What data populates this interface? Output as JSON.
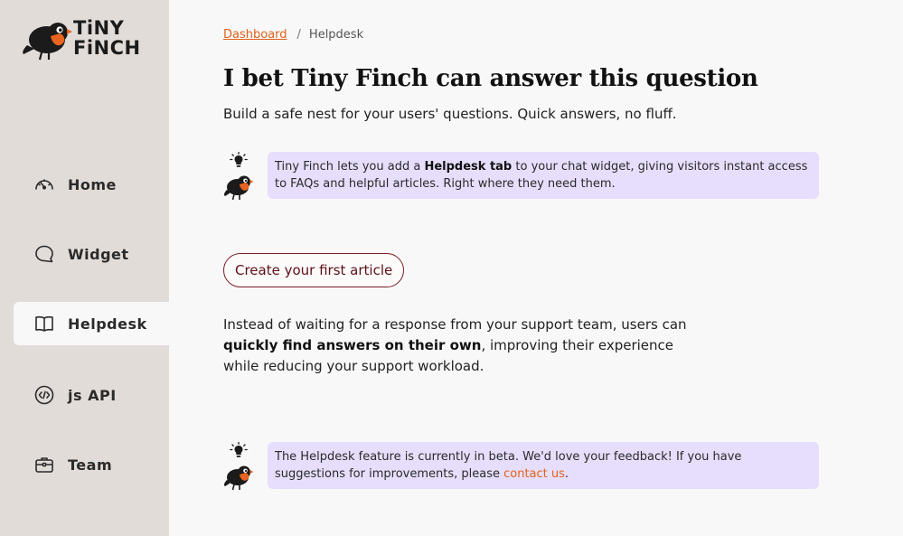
{
  "brand": {
    "line1": "TiNY",
    "line2": "FiNCH"
  },
  "sidebar": {
    "items": [
      {
        "label": "Home",
        "icon": "gauge-icon",
        "active": false
      },
      {
        "label": "Widget",
        "icon": "chat-bubble-icon",
        "active": false
      },
      {
        "label": "Helpdesk",
        "icon": "open-book-icon",
        "active": true
      },
      {
        "label": "js API",
        "icon": "code-icon",
        "active": false
      },
      {
        "label": "Team",
        "icon": "briefcase-icon",
        "active": false
      }
    ]
  },
  "breadcrumb": {
    "parent": "Dashboard",
    "separator": "/",
    "current": "Helpdesk"
  },
  "page": {
    "title": "I bet Tiny Finch can answer this question",
    "subtitle": "Build a safe nest for your users' questions. Quick answers, no fluff."
  },
  "tip1": {
    "text_a": "Tiny Finch lets you add a ",
    "bold": "Helpdesk tab",
    "text_b": " to your chat widget, giving visitors instant access to FAQs and helpful articles. Right where they need them."
  },
  "cta": {
    "label": "Create your first article"
  },
  "description": {
    "text_a": "Instead of waiting for a response from your support team, users can ",
    "bold": "quickly find answers on their own",
    "text_b": ", improving their experience while reducing your support workload."
  },
  "tip2": {
    "text_a": "The Helpdesk feature is currently in beta. We'd love your feedback! If you have suggestions for improvements, please ",
    "link": "contact us",
    "text_b": "."
  },
  "colors": {
    "sidebar_bg": "#e2dcd8",
    "accent": "#e2621b",
    "tip_bg": "#e6defc",
    "cta_border": "#7a1e25"
  }
}
